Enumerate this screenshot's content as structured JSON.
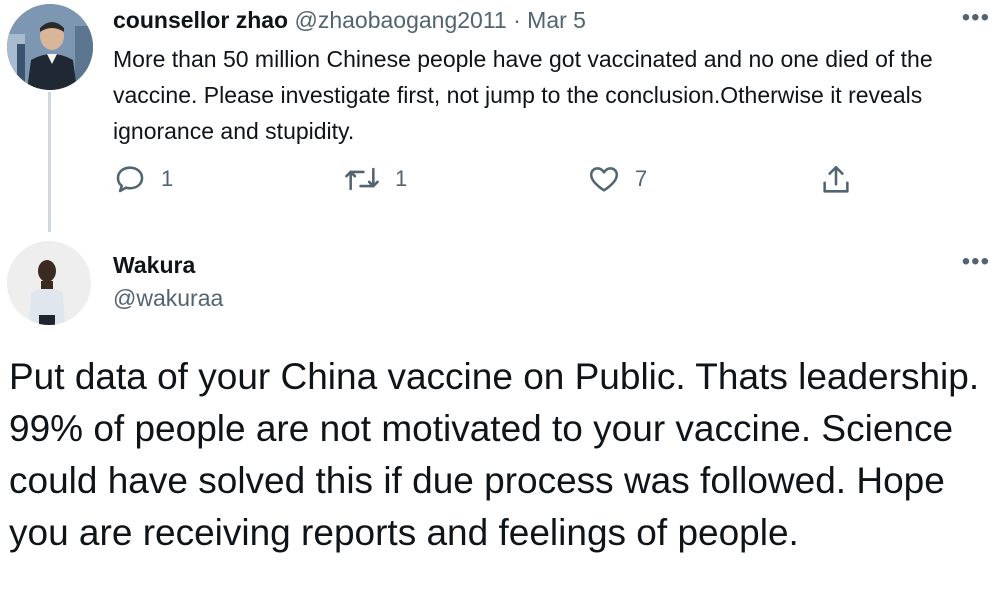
{
  "tweet1": {
    "display_name": "counsellor zhao",
    "handle": "@zhaobaogang2011",
    "separator": "·",
    "date": "Mar 5",
    "more": "•••",
    "text": "More than 50 million Chinese people have got vaccinated and no one died of the vaccine. Please investigate first, not jump to the conclusion.Otherwise it reveals  ignorance and stupidity.",
    "actions": {
      "reply": {
        "icon": "reply-icon",
        "count": "1"
      },
      "retweet": {
        "icon": "retweet-icon",
        "count": "1"
      },
      "like": {
        "icon": "heart-icon",
        "count": "7"
      },
      "share": {
        "icon": "share-icon"
      }
    }
  },
  "tweet2": {
    "display_name": "Wakura",
    "handle": "@wakuraa",
    "more": "•••",
    "text": "Put data of your China vaccine on Public. Thats leadership. 99% of people are not motivated to your vaccine. Science could have solved this if due process was followed. Hope you are receiving reports and feelings of people."
  },
  "colors": {
    "text": "#0f1419",
    "muted": "#536471",
    "thread_line": "#cfd9de"
  }
}
